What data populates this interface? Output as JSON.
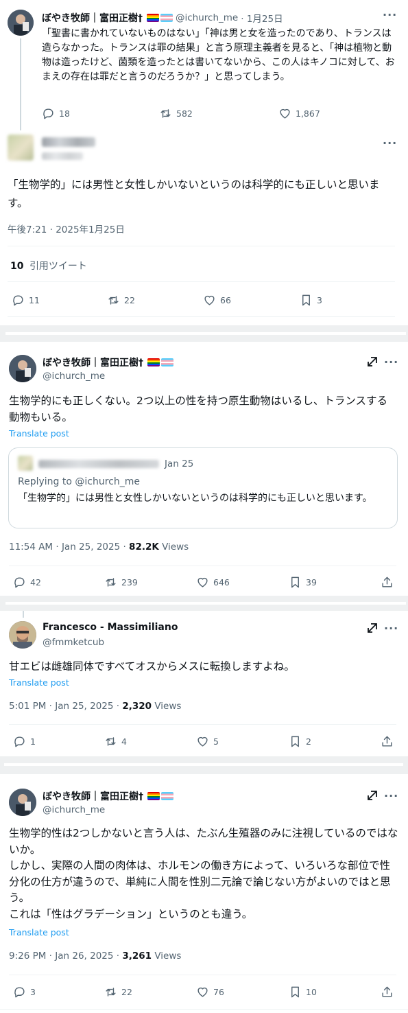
{
  "tweet1": {
    "name": "ぼやき牧師｜富田正樹†",
    "handle": "@ichurch_me",
    "date": "· 1月25日",
    "text": "「聖書に書かれていないものはない」「神は男と女を造ったのであり、トランスは造らなかった。トランスは罪の結果」と言う原理主義者を見ると、「神は植物と動物は造ったけど、菌類を造ったとは書いてないから、この人はキノコに対して、おまえの存在は罪だと言うのだろうか？」と思ってしまう。",
    "replies": "18",
    "retweets": "582",
    "likes": "1,867"
  },
  "tweet2": {
    "text": "「生物学的」には男性と女性しかいないというのは科学的にも正しいと思います。",
    "timestamp": "午後7:21 · 2025年1月25日",
    "quote_count": "10",
    "quote_label": "引用ツイート",
    "replies": "11",
    "retweets": "22",
    "likes": "66",
    "bookmarks": "3"
  },
  "tweet3": {
    "name": "ぼやき牧師｜富田正樹†",
    "handle": "@ichurch_me",
    "text": "生物学的にも正しくない。2つ以上の性を持つ原生動物はいるし、トランスする動物もいる。",
    "translate": "Translate post",
    "quote": {
      "date": "Jan 25",
      "replying": "Replying to @ichurch_me",
      "text": "「生物学的」には男性と女性しかいないというのは科学的にも正しいと思います。"
    },
    "time": "11:54 AM · Jan 25, 2025 · ",
    "views_num": "82.2K",
    "views_label": " Views",
    "replies": "42",
    "retweets": "239",
    "likes": "646",
    "bookmarks": "39"
  },
  "tweet4": {
    "name": "Francesco - Massimiliano",
    "handle": "@fmmketcub",
    "text": "甘エビは雌雄同体ですべてオスからメスに転換しますよね。",
    "translate": "Translate post",
    "time": "5:01 PM · Jan 25, 2025 · ",
    "views_num": "2,320",
    "views_label": " Views",
    "replies": "1",
    "retweets": "4",
    "likes": "5",
    "bookmarks": "2"
  },
  "tweet5": {
    "name": "ぼやき牧師｜富田正樹†",
    "handle": "@ichurch_me",
    "text": "生物学的性は2つしかないと言う人は、たぶん生殖器のみに注視しているのではないか。\nしかし、実際の人間の肉体は、ホルモンの働き方によって、いろいろな部位で性分化の仕方が違うので、単純に人間を性別二元論で論じない方がよいのではと思う。\nこれは「性はグラデーション」というのとも違う。",
    "translate": "Translate post",
    "time": "9:26 PM · Jan 26, 2025 · ",
    "views_num": "3,261",
    "views_label": " Views",
    "replies": "3",
    "retweets": "22",
    "likes": "76",
    "bookmarks": "10"
  },
  "icons": {
    "reply": "reply-icon",
    "retweet": "retweet-icon",
    "like": "heart-icon",
    "bookmark": "bookmark-icon",
    "share": "share-icon",
    "grok": "grok-icon",
    "more": "more-icon"
  },
  "colors": {
    "link": "#1d9bf0",
    "secondary": "#536471",
    "text": "#0f1419"
  }
}
